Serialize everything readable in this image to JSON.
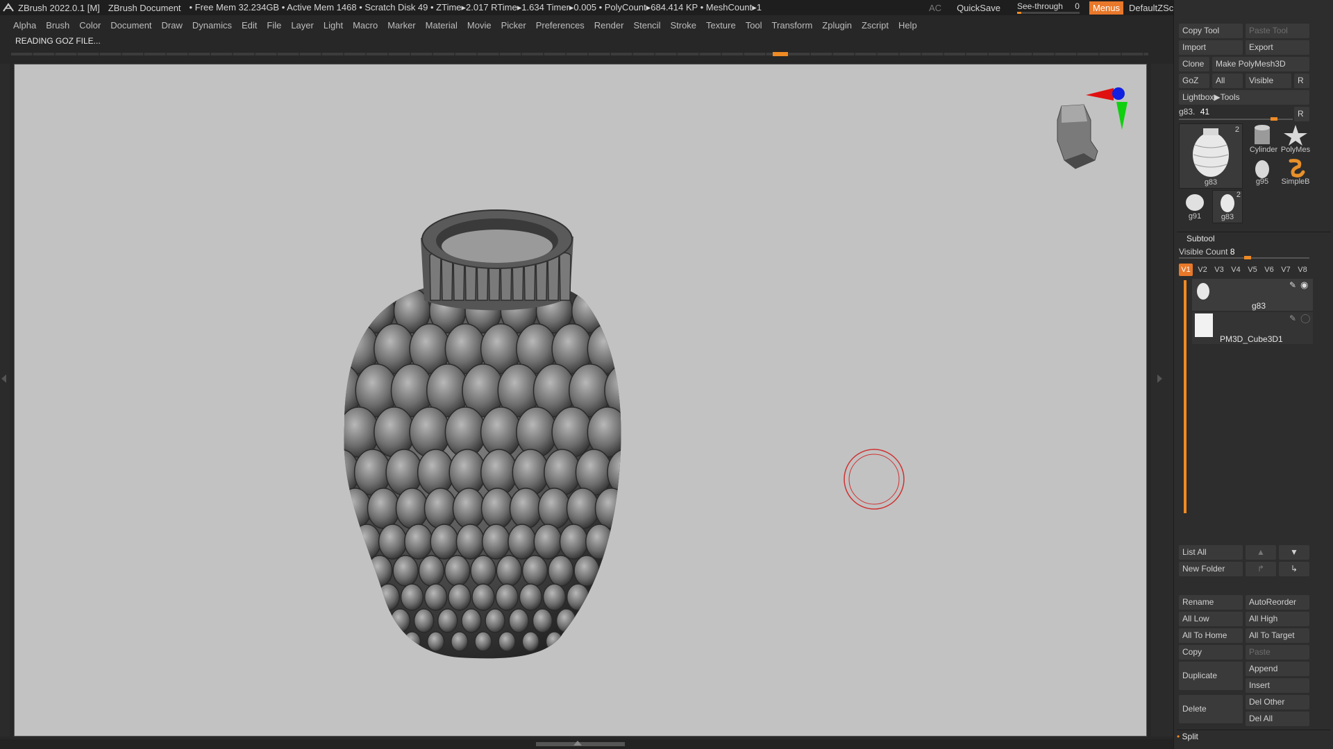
{
  "titlebar": {
    "app_title": "ZBrush 2022.0.1 [M]",
    "document": "ZBrush Document",
    "stats": "• Free Mem 32.234GB • Active Mem 1468 • Scratch Disk 49 • ZTime▸2.017 RTime▸1.634 Timer▸0.005 • PolyCount▸684.414 KP • MeshCount▸1",
    "ac": "AC",
    "quicksave": "QuickSave",
    "see_through_label": "See-through",
    "see_through_value": "0",
    "see_through_level": 0,
    "menus": "Menus",
    "script": "DefaultZScript"
  },
  "menu": [
    "Alpha",
    "Brush",
    "Color",
    "Document",
    "Draw",
    "Dynamics",
    "Edit",
    "File",
    "Layer",
    "Light",
    "Macro",
    "Marker",
    "Material",
    "Movie",
    "Picker",
    "Preferences",
    "Render",
    "Stencil",
    "Stroke",
    "Texture",
    "Tool",
    "Transform",
    "Zplugin",
    "Zscript",
    "Help"
  ],
  "status_text": "READING GOZ FILE...",
  "progress_marker_fraction": 0.67,
  "tool_panel": {
    "copy_tool": "Copy Tool",
    "paste_tool": "Paste Tool",
    "import": "Import",
    "export": "Export",
    "clone": "Clone",
    "make_polymesh": "Make PolyMesh3D",
    "goz": "GoZ",
    "all": "All",
    "visible": "Visible",
    "r": "R",
    "lightbox_tools": "Lightbox▶Tools",
    "current_tool": "g83.",
    "current_value": "41",
    "current_value_fraction": 0.41,
    "thumbs": [
      {
        "label": "g83",
        "badge": "2"
      },
      {
        "label": "Cylinder"
      },
      {
        "label": "PolyMes"
      },
      {
        "label": "g95"
      },
      {
        "label": "SimpleB"
      },
      {
        "label": "g91"
      },
      {
        "label": "g83",
        "badge": "2"
      }
    ]
  },
  "subtool": {
    "title": "Subtool",
    "visible_count_label": "Visible Count",
    "visible_count": "8",
    "visible_count_fraction": 0.5,
    "version_tabs": [
      "V1",
      "V2",
      "V3",
      "V4",
      "V5",
      "V6",
      "V7",
      "V8"
    ],
    "active_tab": "V1",
    "items": [
      {
        "name": "g83",
        "selected": true
      },
      {
        "name": "PM3D_Cube3D1",
        "selected": false
      }
    ],
    "list_all": "List All",
    "new_folder": "New Folder",
    "rename": "Rename",
    "auto_reorder": "AutoReorder",
    "all_low": "All Low",
    "all_high": "All High",
    "all_to_home": "All To Home",
    "all_to_target": "All To Target",
    "copy": "Copy",
    "paste": "Paste",
    "duplicate": "Duplicate",
    "append": "Append",
    "insert": "Insert",
    "delete": "Delete",
    "del_other": "Del Other",
    "del_all": "Del All",
    "split": "Split"
  },
  "colors": {
    "accent": "#e8782a",
    "viewport_bg": "#c2c2c2",
    "cursor_ring": "#d03030"
  }
}
